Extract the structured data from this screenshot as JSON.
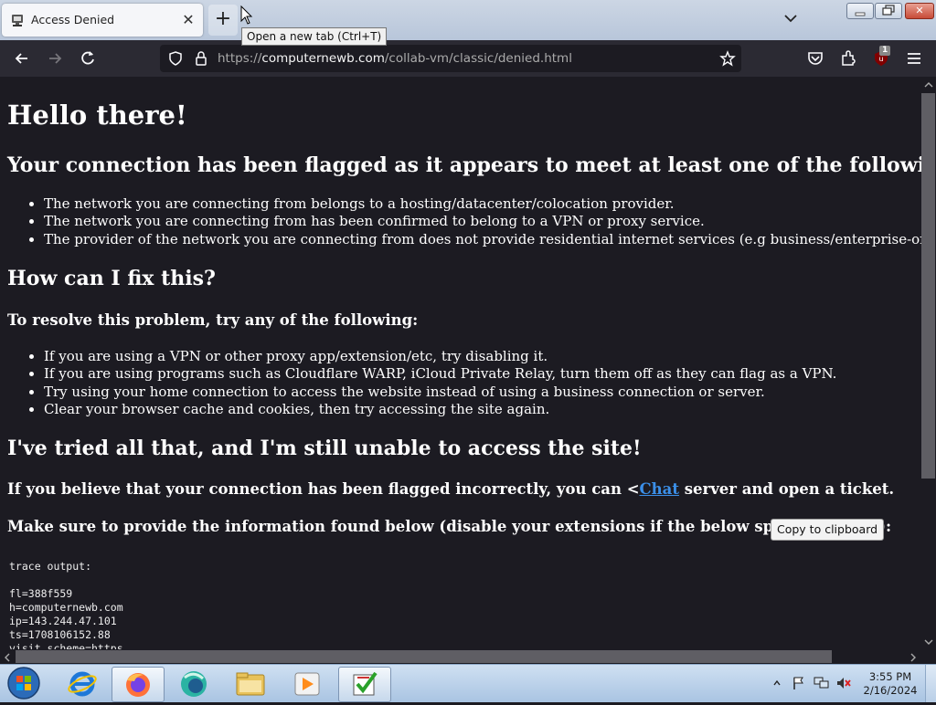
{
  "browser": {
    "tab_title": "Access Denied",
    "new_tab_tooltip": "Open a new tab (Ctrl+T)",
    "url_prefix": "https://",
    "url_host": "computernewb.com",
    "url_path": "/collab-vm/classic/denied.html",
    "extension_badge": "1",
    "icons": [
      "back-icon",
      "forward-icon",
      "reload-icon",
      "shield-icon",
      "lock-icon",
      "star-icon",
      "pocket-icon",
      "extensions-icon",
      "ublock-icon",
      "menu-icon"
    ]
  },
  "page": {
    "heading": "Hello there!",
    "criteria_heading": "Your connection has been flagged as it appears to meet at least one of the following criteria:",
    "criteria": [
      "The network you are connecting from belongs to a hosting/datacenter/colocation provider.",
      "The network you are connecting from has been confirmed to belong to a VPN or proxy service.",
      "The provider of the network you are connecting from does not provide residential internet services (e.g business/enterprise-only networks)."
    ],
    "fix_heading": "How can I fix this?",
    "fix_subheading": "To resolve this problem, try any of the following:",
    "fixes": [
      "If you are using a VPN or other proxy app/extension/etc, try disabling it.",
      "If you are using programs such as Cloudflare WARP, iCloud Private Relay, turn them off as they can flag as a VPN.",
      "Try using your home connection to access the website instead of using a business connection or server.",
      "Clear your browser cache and cookies, then try accessing the site again."
    ],
    "still_heading": "I've tried all that, and I'm still unable to access the site!",
    "ticket_before": "If you believe that your connection has been flagged incorrectly, you can <",
    "ticket_link": "Chat",
    "ticket_after": " server and open a ticket.",
    "info_text": "Make sure to provide the information found below (disable your extensions if the below space is empty):",
    "copy_button": "Copy to clipboard",
    "trace_lines": [
      "trace output:",
      "",
      "fl=388f559",
      "h=computernewb.com",
      "ip=143.244.47.101",
      "ts=1708106152.88",
      "visit_scheme=https"
    ]
  },
  "taskbar": {
    "time": "3:55 PM",
    "date": "2/16/2024",
    "apps": [
      "start-orb-icon",
      "internet-explorer-icon",
      "firefox-icon",
      "edge-like-icon",
      "file-explorer-icon",
      "media-player-icon",
      "app-checklist-icon"
    ]
  },
  "colors": {
    "page_bg": "#1c1b22",
    "toolbar_bg": "#2b2a33",
    "link": "#3b8fe8"
  }
}
